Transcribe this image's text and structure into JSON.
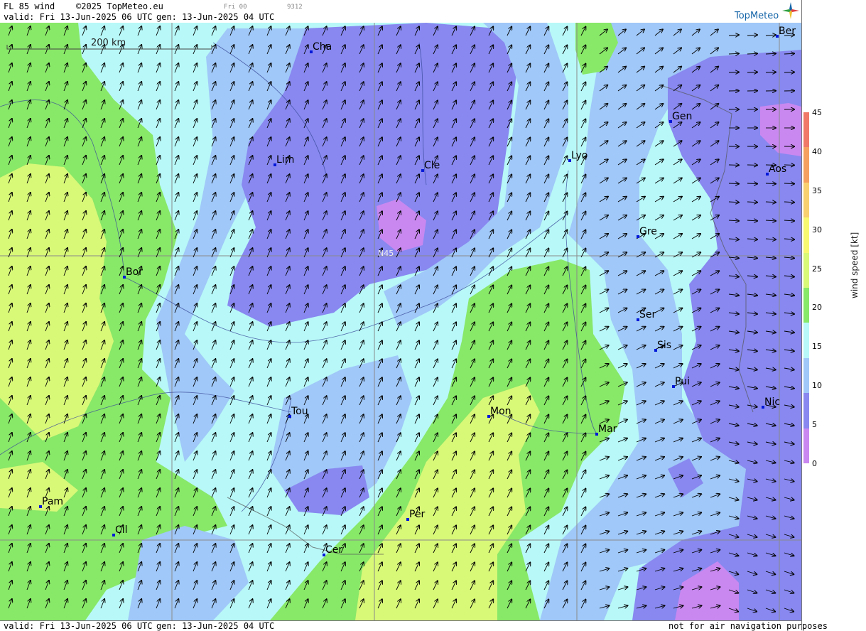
{
  "header": {
    "product": "FL 85 wind",
    "copyright": "©2025 TopMeteo.eu",
    "run_label": "Fri 00",
    "code": "9312",
    "valid": "valid:  Fri  13-Jun-2025  06 UTC",
    "gen": "gen: 13-Jun-2025 04 UTC",
    "logo": "TopMeteo"
  },
  "scale_label": "200 km",
  "grid_label": "N45",
  "footer": {
    "valid": "valid:  Fri  13-Jun-2025  06 UTC",
    "gen": "gen: 13-Jun-2025 04 UTC",
    "disclaimer": "not for air navigation purposes"
  },
  "cities": [
    {
      "name": "Cha"
    },
    {
      "name": "Ber"
    },
    {
      "name": "Gen"
    },
    {
      "name": "Lim"
    },
    {
      "name": "Cle"
    },
    {
      "name": "Lyo"
    },
    {
      "name": "Aos"
    },
    {
      "name": "Gre"
    },
    {
      "name": "Bor"
    },
    {
      "name": "Ser"
    },
    {
      "name": "Sis"
    },
    {
      "name": "Pui"
    },
    {
      "name": "Tou"
    },
    {
      "name": "Mon"
    },
    {
      "name": "Mar"
    },
    {
      "name": "Nic"
    },
    {
      "name": "Pam"
    },
    {
      "name": "Per"
    },
    {
      "name": "Cil"
    },
    {
      "name": "Cer"
    }
  ],
  "legend": {
    "title": "wind  speed  [kt]",
    "ticks": [
      "45",
      "40",
      "35",
      "30",
      "25",
      "20",
      "15",
      "10",
      "5",
      "0"
    ],
    "colors": [
      "#f07868",
      "#f6a060",
      "#f8d070",
      "#f8f870",
      "#d8f878",
      "#88e868",
      "#b8f8f8",
      "#a0c8f8",
      "#8888f0",
      "#c888f0"
    ]
  }
}
